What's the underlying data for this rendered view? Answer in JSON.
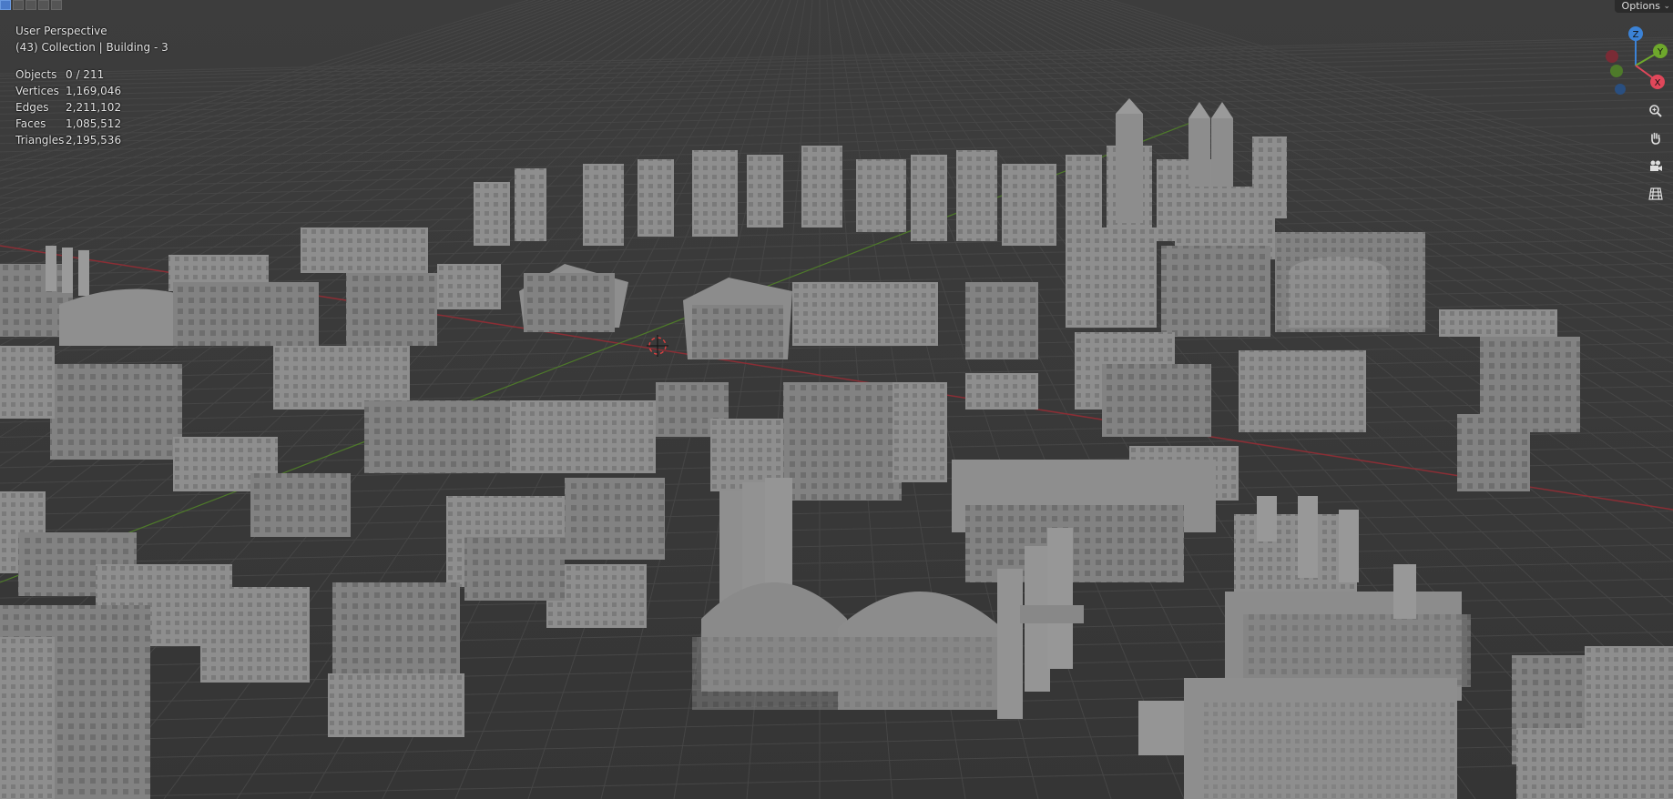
{
  "viewport": {
    "view_name": "User Perspective",
    "collection_line": "(43) Collection | Building - 3",
    "stats": [
      {
        "label": "Objects",
        "value": "0 / 211"
      },
      {
        "label": "Vertices",
        "value": "1,169,046"
      },
      {
        "label": "Edges",
        "value": "2,211,102"
      },
      {
        "label": "Faces",
        "value": "1,085,512"
      },
      {
        "label": "Triangles",
        "value": "2,195,536"
      }
    ]
  },
  "header": {
    "options_label": "Options",
    "mode_buttons": [
      "select-box-icon",
      "select-extend-icon",
      "select-subtract-icon",
      "select-invert-icon",
      "select-intersect-icon"
    ]
  },
  "gizmo": {
    "z_label": "Z",
    "y_label": "Y",
    "x_label": "X",
    "x_color": "#e0475a",
    "y_color": "#6ea82c",
    "z_color": "#3b82d6"
  },
  "nav_tools": [
    "zoom-icon",
    "hand-pan-icon",
    "camera-icon",
    "grid-ortho-icon"
  ],
  "colors": {
    "background": "#3a3a3a",
    "grid": "#454545",
    "x_axis_line": "#8a2e35",
    "y_axis_line": "#4e7a2a",
    "building": "#8a8a8a"
  }
}
